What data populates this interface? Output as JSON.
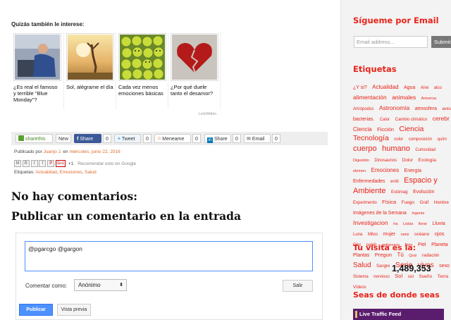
{
  "related": {
    "title": "Quizás también le interese:",
    "items": [
      {
        "caption": "¿Es real el famoso y terrible \"Blue Monday\"?"
      },
      {
        "caption": "Sol, alégrame el día"
      },
      {
        "caption": "Cada vez menos emociones básicas"
      },
      {
        "caption": "¿Por qué duele tanto el desamor?"
      }
    ],
    "credit": "LinkWithin"
  },
  "share": {
    "sharethis": "sharethis",
    "new": "New",
    "facebook": "Share",
    "facebook_count": "0",
    "tweet": "Tweet",
    "tweet_count": "0",
    "meneame": "Meneame",
    "meneame_count": "0",
    "linkedin": "Share",
    "linkedin_count": "0",
    "email": "Email",
    "email_count": "0"
  },
  "post_meta": {
    "published_by": "Publicado por",
    "author": "Juanjo J.",
    "en": "en",
    "date": "miércoles, junio 22, 2016",
    "gplus_label": "G+1",
    "plus_one": "+1",
    "recommend": "Recomendar esto en Google",
    "labels_title": "Etiquetas:",
    "labels": [
      "Actualidad",
      "Emociones",
      "Salud"
    ]
  },
  "comments": {
    "no_comments": "No hay comentarios:",
    "post_comment": "Publicar un comentario en la entrada",
    "textarea_value": "@pgarcgo  @gargon",
    "comment_as": "Comentar como:",
    "identity": "Anónimo",
    "salir": "Salir",
    "publicar": "Publicar",
    "vista_previa": "Vista previa"
  },
  "sidebar": {
    "follow_title": "Sígueme por Email",
    "email_placeholder": "Email address...",
    "submit": "Submit",
    "tags_title": "Etiquetas",
    "tags": [
      {
        "t": "¿Y si?",
        "s": 7
      },
      {
        "t": "Actualidad",
        "s": 8
      },
      {
        "t": "Agua",
        "s": 7
      },
      {
        "t": "Aire",
        "s": 6.5
      },
      {
        "t": "alco",
        "s": 6
      },
      {
        "t": "alimentación",
        "s": 8.5
      },
      {
        "t": "animales",
        "s": 8.5
      },
      {
        "t": "Aniversa",
        "s": 5.5
      },
      {
        "t": "Artrópodos",
        "s": 6
      },
      {
        "t": "Astronomía",
        "s": 8.5
      },
      {
        "t": "atmosfera",
        "s": 7
      },
      {
        "t": "aves",
        "s": 6
      },
      {
        "t": "bacterias.",
        "s": 7
      },
      {
        "t": "Calor",
        "s": 6
      },
      {
        "t": "Cambio climático",
        "s": 6
      },
      {
        "t": "cerebr",
        "s": 8.5
      },
      {
        "t": "Ciencia",
        "s": 8
      },
      {
        "t": "Ficción",
        "s": 7.5
      },
      {
        "t": "Ciencia",
        "s": 10.5
      },
      {
        "t": "Tecnología",
        "s": 10.5
      },
      {
        "t": "color",
        "s": 6
      },
      {
        "t": "composición",
        "s": 6
      },
      {
        "t": "quím",
        "s": 6
      },
      {
        "t": "cuerpo",
        "s": 11
      },
      {
        "t": "humano",
        "s": 11
      },
      {
        "t": "Curiosidad",
        "s": 6
      },
      {
        "t": "Digestión",
        "s": 5.5
      },
      {
        "t": "Dinosaurios",
        "s": 6
      },
      {
        "t": "Dolor",
        "s": 6.5
      },
      {
        "t": "Ecología",
        "s": 6.5
      },
      {
        "t": "elemen",
        "s": 5.5
      },
      {
        "t": "Emociones",
        "s": 8
      },
      {
        "t": "Energía",
        "s": 7
      },
      {
        "t": "Enfermedades",
        "s": 7
      },
      {
        "t": "eróti",
        "s": 6
      },
      {
        "t": "Espacio y Ambiente",
        "s": 11
      },
      {
        "t": "Estómag",
        "s": 6
      },
      {
        "t": "Evolución",
        "s": 7
      },
      {
        "t": "Experimento",
        "s": 6
      },
      {
        "t": "Física",
        "s": 7.5
      },
      {
        "t": "Fuego",
        "s": 6.5
      },
      {
        "t": "Gráf",
        "s": 6.5
      },
      {
        "t": "Hombre",
        "s": 6
      },
      {
        "t": "Imágenes de la Semana",
        "s": 7
      },
      {
        "t": "Ingenie",
        "s": 5.5
      },
      {
        "t": "Investigacion",
        "s": 8.5
      },
      {
        "t": "Ira",
        "s": 5.5
      },
      {
        "t": "Listas",
        "s": 5.5
      },
      {
        "t": "llorar",
        "s": 5.5
      },
      {
        "t": "Lluvia",
        "s": 7
      },
      {
        "t": "Luna",
        "s": 6
      },
      {
        "t": "Mitos",
        "s": 6
      },
      {
        "t": "mujer",
        "s": 7
      },
      {
        "t": "nariz",
        "s": 5.5
      },
      {
        "t": "océano",
        "s": 6.5
      },
      {
        "t": "ojos",
        "s": 7.5
      },
      {
        "t": "Olor",
        "s": 6
      },
      {
        "t": "palab",
        "s": 6
      },
      {
        "t": "peligrosos",
        "s": 5.5
      },
      {
        "t": "Pelo",
        "s": 5.5
      },
      {
        "t": "Piel",
        "s": 7
      },
      {
        "t": "Planeta",
        "s": 7
      },
      {
        "t": "Plantas",
        "s": 7
      },
      {
        "t": "Pregun",
        "s": 7.5
      },
      {
        "t": "Tú",
        "s": 8
      },
      {
        "t": "Quiz",
        "s": 5.5
      },
      {
        "t": "radiación",
        "s": 6
      },
      {
        "t": "Salud",
        "s": 10
      },
      {
        "t": "Sangre",
        "s": 6
      },
      {
        "t": "Serie",
        "s": 10.5
      },
      {
        "t": "vivos",
        "s": 10
      },
      {
        "t": "sexo",
        "s": 7
      },
      {
        "t": "Sistema",
        "s": 6
      },
      {
        "t": "nervioso",
        "s": 6
      },
      {
        "t": "Sol",
        "s": 7.5
      },
      {
        "t": "sol",
        "s": 6.5
      },
      {
        "t": "Sueño",
        "s": 6.5
      },
      {
        "t": "Tierra",
        "s": 6
      },
      {
        "t": "Vídeos",
        "s": 6
      }
    ],
    "visits_title": "Tu visita es la:",
    "visits": "1,489,353",
    "origin_title": "Seas de donde seas",
    "feed_label": "Live Traffic Feed"
  },
  "colors": {
    "accent_red": "#e8231a",
    "link_orange": "#e06a2a",
    "primary_blue": "#4d90fe"
  }
}
